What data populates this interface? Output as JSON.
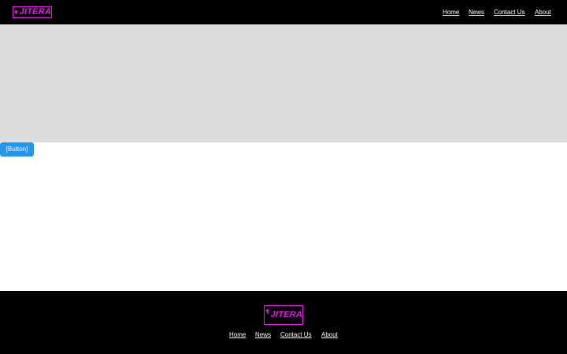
{
  "brand": {
    "logo_text": "JITERA",
    "accent_color": "#e619e6",
    "logo_icon": "brand-mark-icon"
  },
  "header": {
    "nav": [
      {
        "label": "Home"
      },
      {
        "label": "News"
      },
      {
        "label": "Contact Us"
      },
      {
        "label": "About"
      }
    ]
  },
  "main": {
    "button_label": "[Button]",
    "button_color": "#2196f3",
    "hero_color": "#dddddd"
  },
  "footer": {
    "nav": [
      {
        "label": "Home"
      },
      {
        "label": "News"
      },
      {
        "label": "Contact Us"
      },
      {
        "label": "About"
      }
    ]
  }
}
